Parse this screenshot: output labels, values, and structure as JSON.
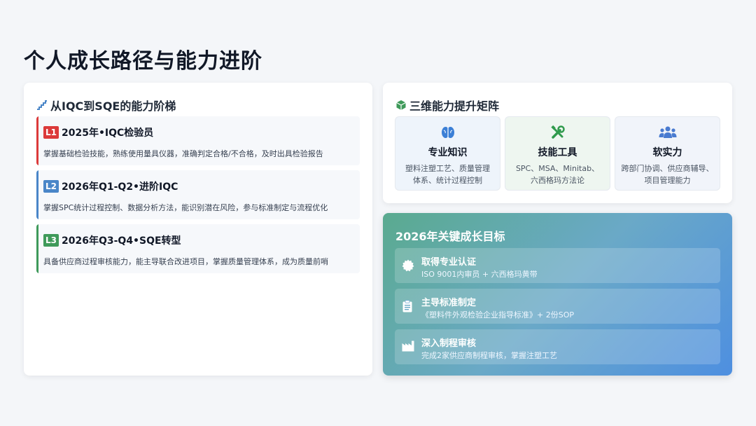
{
  "page": {
    "title": "个人成长路径与能力进阶"
  },
  "ladder": {
    "heading": "从IQC到SQE的能力阶梯",
    "levels": [
      {
        "badge": "L1",
        "title": "2025年•IQC检验员",
        "desc": "掌握基础检验技能，熟练使用量具仪器，准确判定合格/不合格，及时出具检验报告",
        "color": "#dc3a3a"
      },
      {
        "badge": "L2",
        "title": "2026年Q1-Q2•进阶IQC",
        "desc": "掌握SPC统计过程控制、数据分析方法，能识别潜在风险，参与标准制定与流程优化",
        "color": "#4a86c8"
      },
      {
        "badge": "L3",
        "title": "2026年Q3-Q4•SQE转型",
        "desc": "具备供应商过程审核能力，能主导联合改进项目，掌握质量管理体系，成为质量前哨",
        "color": "#3f9a5a"
      }
    ]
  },
  "matrix": {
    "heading": "三维能力提升矩阵",
    "cells": [
      {
        "icon": "brain-icon",
        "title": "专业知识",
        "desc_lines": [
          "塑料注塑工艺、质量管理",
          "体系、统计过程控制"
        ],
        "bg": "#eef4fb",
        "icon_color": "#3b7fd6"
      },
      {
        "icon": "tools-icon",
        "title": "技能工具",
        "desc_lines": [
          "SPC、MSA、Minitab、",
          "六西格玛方法论"
        ],
        "bg": "#eef6f0",
        "icon_color": "#2f9a4c"
      },
      {
        "icon": "users-icon",
        "title": "软实力",
        "desc_lines": [
          "跨部门协调、供应商辅导、",
          "项目管理能力"
        ],
        "bg": "#f1f4fa",
        "icon_color": "#4a7bd0"
      }
    ]
  },
  "goals": {
    "heading": "2026年关键成长目标",
    "items": [
      {
        "icon": "certificate-icon",
        "title": "取得专业认证",
        "desc": "ISO 9001内审员 + 六西格玛黄带"
      },
      {
        "icon": "clipboard-icon",
        "title": "主导标准制定",
        "desc": "《塑料件外观检验企业指导标准》+ 2份SOP"
      },
      {
        "icon": "factory-icon",
        "title": "深入制程审核",
        "desc": "完成2家供应商制程审核，掌握注塑工艺"
      }
    ]
  }
}
